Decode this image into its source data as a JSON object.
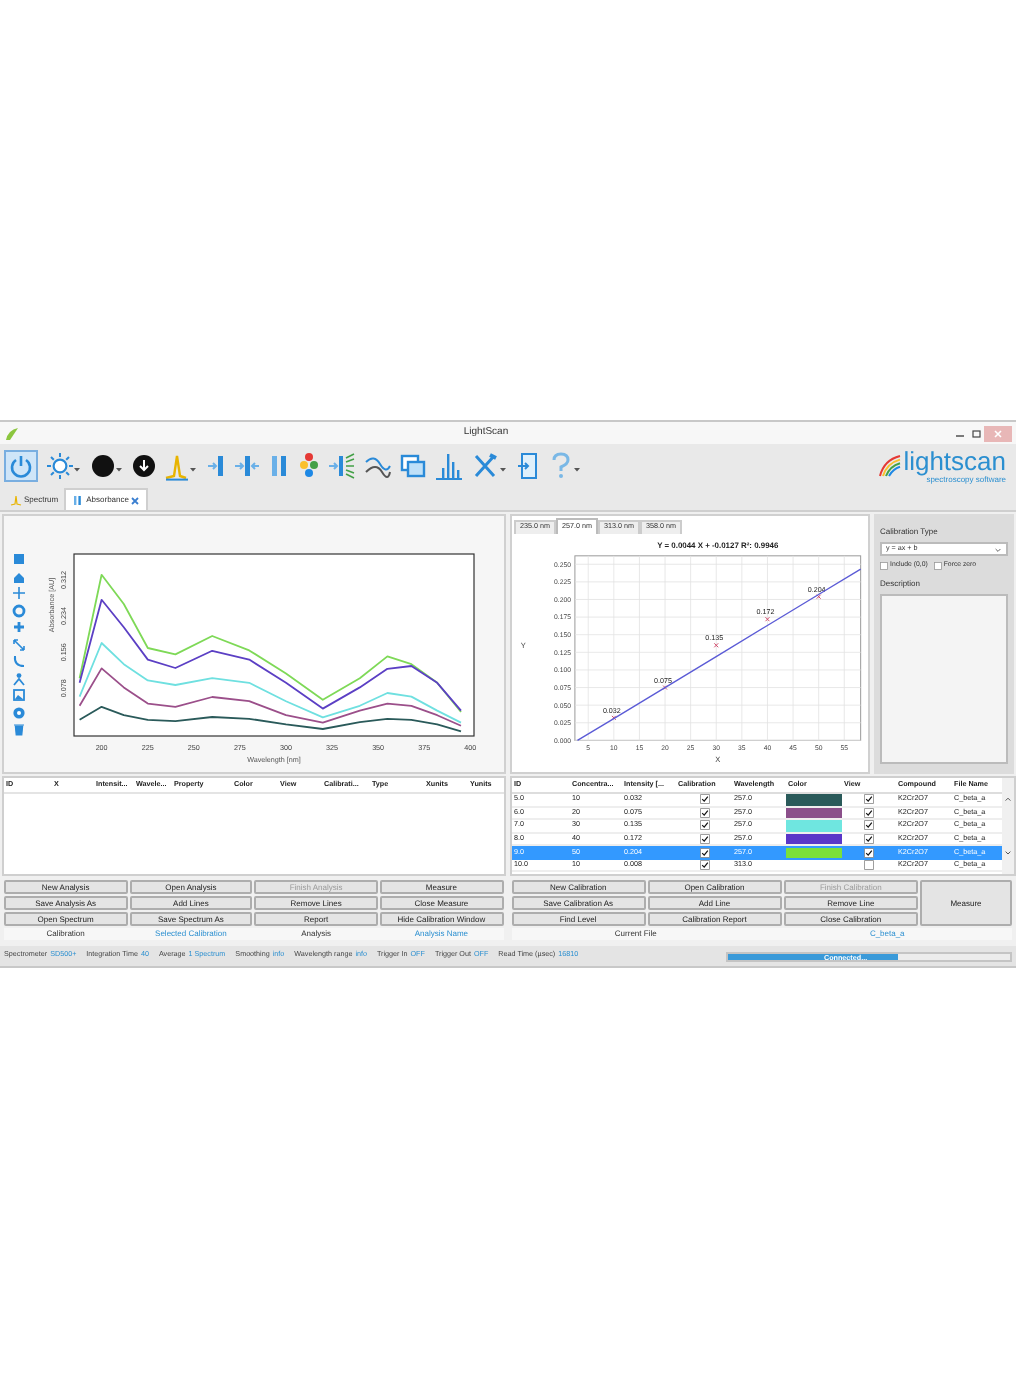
{
  "window": {
    "title": "LightScan"
  },
  "logo": {
    "name": "lightscan",
    "tagline": "spectroscopy software"
  },
  "tabs": [
    {
      "label": "Spectrum",
      "selected": false,
      "closable": false
    },
    {
      "label": "Absorbance",
      "selected": true,
      "closable": true
    }
  ],
  "spectrum_chart": {
    "chart_data": {
      "type": "line",
      "xlabel": "Wavelength [nm]",
      "ylabel": "Absorbance [AU]",
      "x": [
        188,
        200,
        212,
        225,
        240,
        260,
        280,
        300,
        320,
        340,
        355,
        368,
        382,
        395
      ],
      "series": [
        {
          "color": "#7ed957",
          "values": [
            0.1,
            0.323,
            0.26,
            0.165,
            0.151,
            0.191,
            0.16,
            0.11,
            0.053,
            0.1,
            0.147,
            0.13,
            0.09,
            0.027
          ]
        },
        {
          "color": "#5b3fc4",
          "values": [
            0.09,
            0.269,
            0.21,
            0.14,
            0.122,
            0.159,
            0.14,
            0.09,
            0.034,
            0.08,
            0.12,
            0.126,
            0.09,
            0.03
          ]
        },
        {
          "color": "#6fe0e0",
          "values": [
            0.06,
            0.176,
            0.13,
            0.095,
            0.085,
            0.1,
            0.09,
            0.05,
            0.015,
            0.04,
            0.068,
            0.06,
            0.03,
            0.004
          ]
        },
        {
          "color": "#9b4f8a",
          "values": [
            0.04,
            0.121,
            0.08,
            0.045,
            0.038,
            0.059,
            0.05,
            0.02,
            0.004,
            0.03,
            0.045,
            0.04,
            0.02,
            -0.003
          ]
        },
        {
          "color": "#2a5a5a",
          "values": [
            0.01,
            0.038,
            0.02,
            0.01,
            0.007,
            0.016,
            0.012,
            0.0,
            -0.01,
            0.005,
            0.012,
            0.01,
            0.0,
            -0.015
          ]
        }
      ],
      "xlim": [
        185,
        402
      ],
      "ylim": [
        -0.025,
        0.368
      ],
      "xticks": [
        200,
        225,
        250,
        275,
        300,
        325,
        350,
        375,
        400
      ],
      "yticks": [
        0.078,
        0.156,
        0.234,
        0.312
      ]
    }
  },
  "calibration_chart": {
    "tabs": [
      {
        "label": "235.0 nm",
        "selected": false
      },
      {
        "label": "257.0 nm",
        "selected": true
      },
      {
        "label": "313.0 nm",
        "selected": false
      },
      {
        "label": "358.0 nm",
        "selected": false
      }
    ],
    "chart_data": {
      "type": "scatter",
      "title": "Y = 0.0044 X + -0.0127 R²: 0.9946",
      "xlabel": "X",
      "ylabel": "Y",
      "x": [
        2.9,
        10,
        20,
        30,
        40,
        50,
        58.2
      ],
      "series": [
        {
          "type": "scatter",
          "color": "#d04a6a",
          "values": [
            null,
            0.032,
            0.075,
            0.135,
            0.172,
            0.204,
            null
          ],
          "value_labels": [
            null,
            "0.032",
            "0.075",
            "0.135",
            "0.172",
            "0.204",
            null
          ]
        },
        {
          "type": "line",
          "color": "#5b5bd6",
          "values": [
            0,
            0.031,
            0.075,
            0.119,
            0.163,
            0.207,
            0.243
          ]
        }
      ],
      "grid": true,
      "xlim": [
        2.4,
        58.2
      ],
      "ylim": [
        0,
        0.262
      ],
      "xticks": [
        5,
        10,
        15,
        20,
        25,
        30,
        35,
        40,
        45,
        50,
        55
      ],
      "yticks": [
        {
          "value": 0,
          "label": "0.000"
        },
        {
          "value": 0.025,
          "label": "0.025"
        },
        {
          "value": 0.05,
          "label": "0.050"
        },
        {
          "value": 0.075,
          "label": "0.075"
        },
        {
          "value": 0.1,
          "label": "0.100"
        },
        {
          "value": 0.125,
          "label": "0.125"
        },
        {
          "value": 0.15,
          "label": "0.150"
        },
        {
          "value": 0.175,
          "label": "0.175"
        },
        {
          "value": 0.2,
          "label": "0.200"
        },
        {
          "value": 0.225,
          "label": "0.225"
        },
        {
          "value": 0.25,
          "label": "0.250"
        }
      ]
    }
  },
  "calibration_panel": {
    "type_label": "Calibration Type",
    "type_value": "y = ax + b",
    "options": [
      {
        "label": "Include (0,0)",
        "checked": false
      },
      {
        "label": "Force zero",
        "checked": false
      }
    ],
    "description_label": "Description"
  },
  "analysis_table": {
    "columns": [
      "ID",
      "X",
      "Intensit...",
      "Wavele...",
      "Property",
      "Color",
      "View",
      "Calibrati...",
      "Type",
      "Xunits",
      "Yunits"
    ]
  },
  "calibration_table": {
    "columns": [
      "ID",
      "Concentra...",
      "Intensity [...",
      "Calibration",
      "Wavelength",
      "Color",
      "View",
      "Compound",
      "File Name"
    ],
    "rows": [
      {
        "id": "5.0",
        "concentration": "10",
        "intensity": "0.032",
        "calibration": true,
        "wavelength": "257.0",
        "color": "#2a5a5a",
        "view": true,
        "compound": "K2Cr2O7",
        "file_name": "C_beta_a",
        "selected": false
      },
      {
        "id": "6.0",
        "concentration": "20",
        "intensity": "0.075",
        "calibration": true,
        "wavelength": "257.0",
        "color": "#8b4f8a",
        "view": true,
        "compound": "K2Cr2O7",
        "file_name": "C_beta_a",
        "selected": false
      },
      {
        "id": "7.0",
        "concentration": "30",
        "intensity": "0.135",
        "calibration": true,
        "wavelength": "257.0",
        "color": "#6fe6e0",
        "view": true,
        "compound": "K2Cr2O7",
        "file_name": "C_beta_a",
        "selected": false
      },
      {
        "id": "8.0",
        "concentration": "40",
        "intensity": "0.172",
        "calibration": true,
        "wavelength": "257.0",
        "color": "#5a36c8",
        "view": true,
        "compound": "K2Cr2O7",
        "file_name": "C_beta_a",
        "selected": false
      },
      {
        "id": "9.0",
        "concentration": "50",
        "intensity": "0.204",
        "calibration": true,
        "wavelength": "257.0",
        "color": "#7be03a",
        "view": true,
        "compound": "K2Cr2O7",
        "file_name": "C_beta_a",
        "selected": true
      },
      {
        "id": "10.0",
        "concentration": "10",
        "intensity": "0.008",
        "calibration": true,
        "wavelength": "313.0",
        "view": false,
        "compound": "K2Cr2O7",
        "file_name": "C_beta_a",
        "selected": false
      }
    ]
  },
  "analysis_buttons": [
    {
      "label": "New Analysis",
      "disabled": false
    },
    {
      "label": "Open Analysis",
      "disabled": false
    },
    {
      "label": "Finish Analysis",
      "disabled": true
    },
    {
      "label": "Measure",
      "disabled": false
    },
    {
      "label": "Save Analysis As",
      "disabled": false
    },
    {
      "label": "Add Lines",
      "disabled": false
    },
    {
      "label": "Remove Lines",
      "disabled": false
    },
    {
      "label": "Close Measure",
      "disabled": false
    },
    {
      "label": "Open Spectrum",
      "disabled": false
    },
    {
      "label": "Save Spectrum As",
      "disabled": false
    },
    {
      "label": "Report",
      "disabled": false
    },
    {
      "label": "Hide Calibration Window",
      "disabled": false
    }
  ],
  "analysis_info": [
    {
      "text": "Calibration",
      "kind": "label"
    },
    {
      "text": "Selected Calibration",
      "kind": "value"
    },
    {
      "text": "Analysis",
      "kind": "label"
    },
    {
      "text": "Analysis Name",
      "kind": "value"
    }
  ],
  "calibration_buttons": [
    {
      "label": "New Calibration",
      "disabled": false
    },
    {
      "label": "Open Calibration",
      "disabled": false
    },
    {
      "label": "Finish Calibration",
      "disabled": true
    },
    {
      "label": "Save Calibration As",
      "disabled": false
    },
    {
      "label": "Add Line",
      "disabled": false
    },
    {
      "label": "Remove Line",
      "disabled": false
    },
    {
      "label": "Find Level",
      "disabled": false
    },
    {
      "label": "Calibration Report",
      "disabled": false
    },
    {
      "label": "Close Calibration",
      "disabled": false
    }
  ],
  "calibration_measure_button": {
    "label": "Measure",
    "disabled": false
  },
  "calibration_info": [
    {
      "text": "Current File",
      "kind": "label"
    },
    {
      "text": "C_beta_a",
      "kind": "value"
    }
  ],
  "status_bar": {
    "items": [
      {
        "label": "Spectrometer",
        "value": "SD500+"
      },
      {
        "label": "Integration Time",
        "value": "40"
      },
      {
        "label": "Average",
        "value": "1 Spectrum"
      },
      {
        "label": "Smoothing",
        "value": "info"
      },
      {
        "label": "Wavelength range",
        "value": "info"
      },
      {
        "label": "Trigger In",
        "value": "OFF"
      },
      {
        "label": "Trigger Out",
        "value": "OFF"
      },
      {
        "label": "Read Time (µsec)",
        "value": "16810"
      }
    ],
    "connection": {
      "label": "Connected...",
      "level": 0.6
    }
  }
}
